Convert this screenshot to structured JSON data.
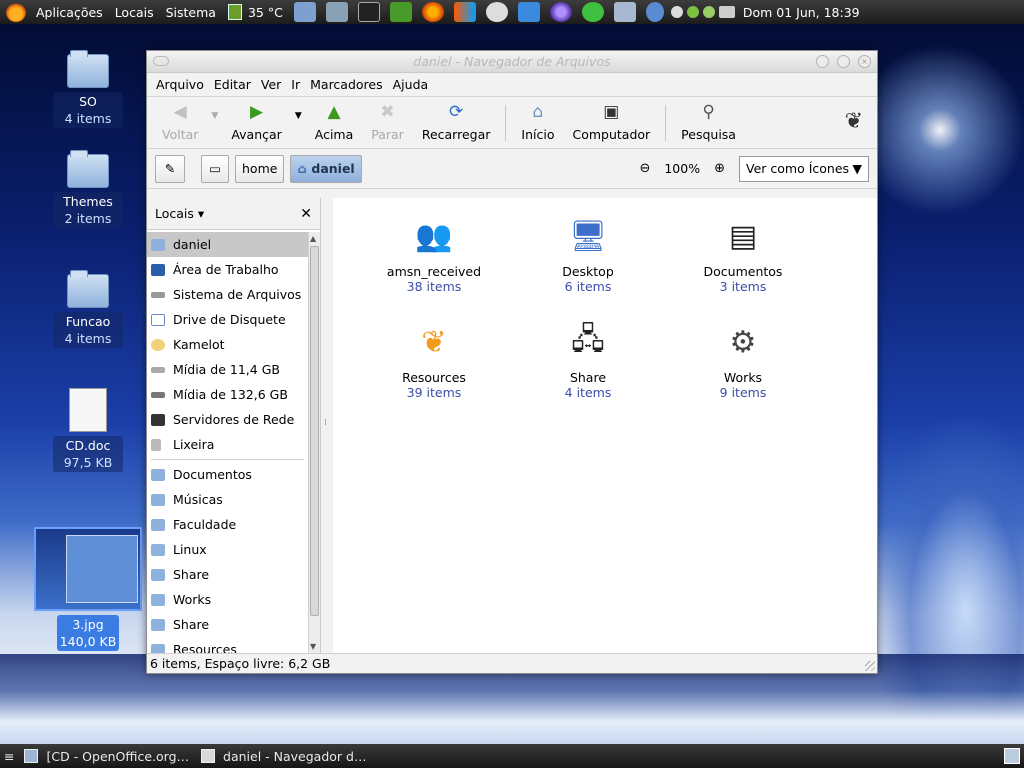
{
  "top_panel": {
    "menus": [
      "Aplicações",
      "Locais",
      "Sistema"
    ],
    "temperature": "35 °C",
    "clock": "Dom 01 Jun, 18:39"
  },
  "desktop": {
    "icons": [
      {
        "name": "SO",
        "sub": "4 items"
      },
      {
        "name": "Themes",
        "sub": "2 items"
      },
      {
        "name": "Funcao",
        "sub": "4 items"
      },
      {
        "name": "CD.doc",
        "sub": "97,5 KB"
      },
      {
        "name": "3.jpg",
        "sub": "140,0 KB"
      }
    ]
  },
  "window": {
    "title": "daniel - Navegador de Arquivos",
    "menubar": [
      "Arquivo",
      "Editar",
      "Ver",
      "Ir",
      "Marcadores",
      "Ajuda"
    ],
    "toolbar": {
      "back": "Voltar",
      "forward": "Avançar",
      "up": "Acima",
      "stop": "Parar",
      "reload": "Recarregar",
      "home": "Início",
      "computer": "Computador",
      "search": "Pesquisa"
    },
    "location": {
      "crumbs": [
        "home",
        "daniel"
      ],
      "zoom": "100%",
      "view_mode": "Ver como Ícones"
    },
    "sidebar": {
      "header": "Locais ▾",
      "places": [
        {
          "label": "daniel",
          "selected": true
        },
        {
          "label": "Área de Trabalho"
        },
        {
          "label": "Sistema de Arquivos"
        },
        {
          "label": "Drive de Disquete"
        },
        {
          "label": "Kamelot"
        },
        {
          "label": "Mídia de 11,4 GB"
        },
        {
          "label": "Mídia de 132,6 GB"
        },
        {
          "label": "Servidores de Rede"
        },
        {
          "label": "Lixeira"
        }
      ],
      "bookmarks": [
        "Documentos",
        "Músicas",
        "Faculdade",
        "Linux",
        "Share",
        "Works",
        "Share",
        "Resources"
      ]
    },
    "files": [
      {
        "name": "amsn_received",
        "count": "38 items",
        "icon": "people-icon"
      },
      {
        "name": "Desktop",
        "count": "6 items",
        "icon": "desktop-icon"
      },
      {
        "name": "Documentos",
        "count": "3 items",
        "icon": "server-icon"
      },
      {
        "name": "Resources",
        "count": "39 items",
        "icon": "gnome-foot-icon"
      },
      {
        "name": "Share",
        "count": "4 items",
        "icon": "network-icon"
      },
      {
        "name": "Works",
        "count": "9 items",
        "icon": "terminal-gear-icon"
      }
    ],
    "status": "6 items, Espaço livre: 6,2 GB"
  },
  "taskbar": {
    "tasks": [
      "[CD - OpenOffice.org…",
      "daniel - Navegador d…"
    ]
  },
  "colors": {
    "selection": "#3b7ce3",
    "file_count": "#3b4ea8",
    "panel": "#2a2a2a"
  }
}
